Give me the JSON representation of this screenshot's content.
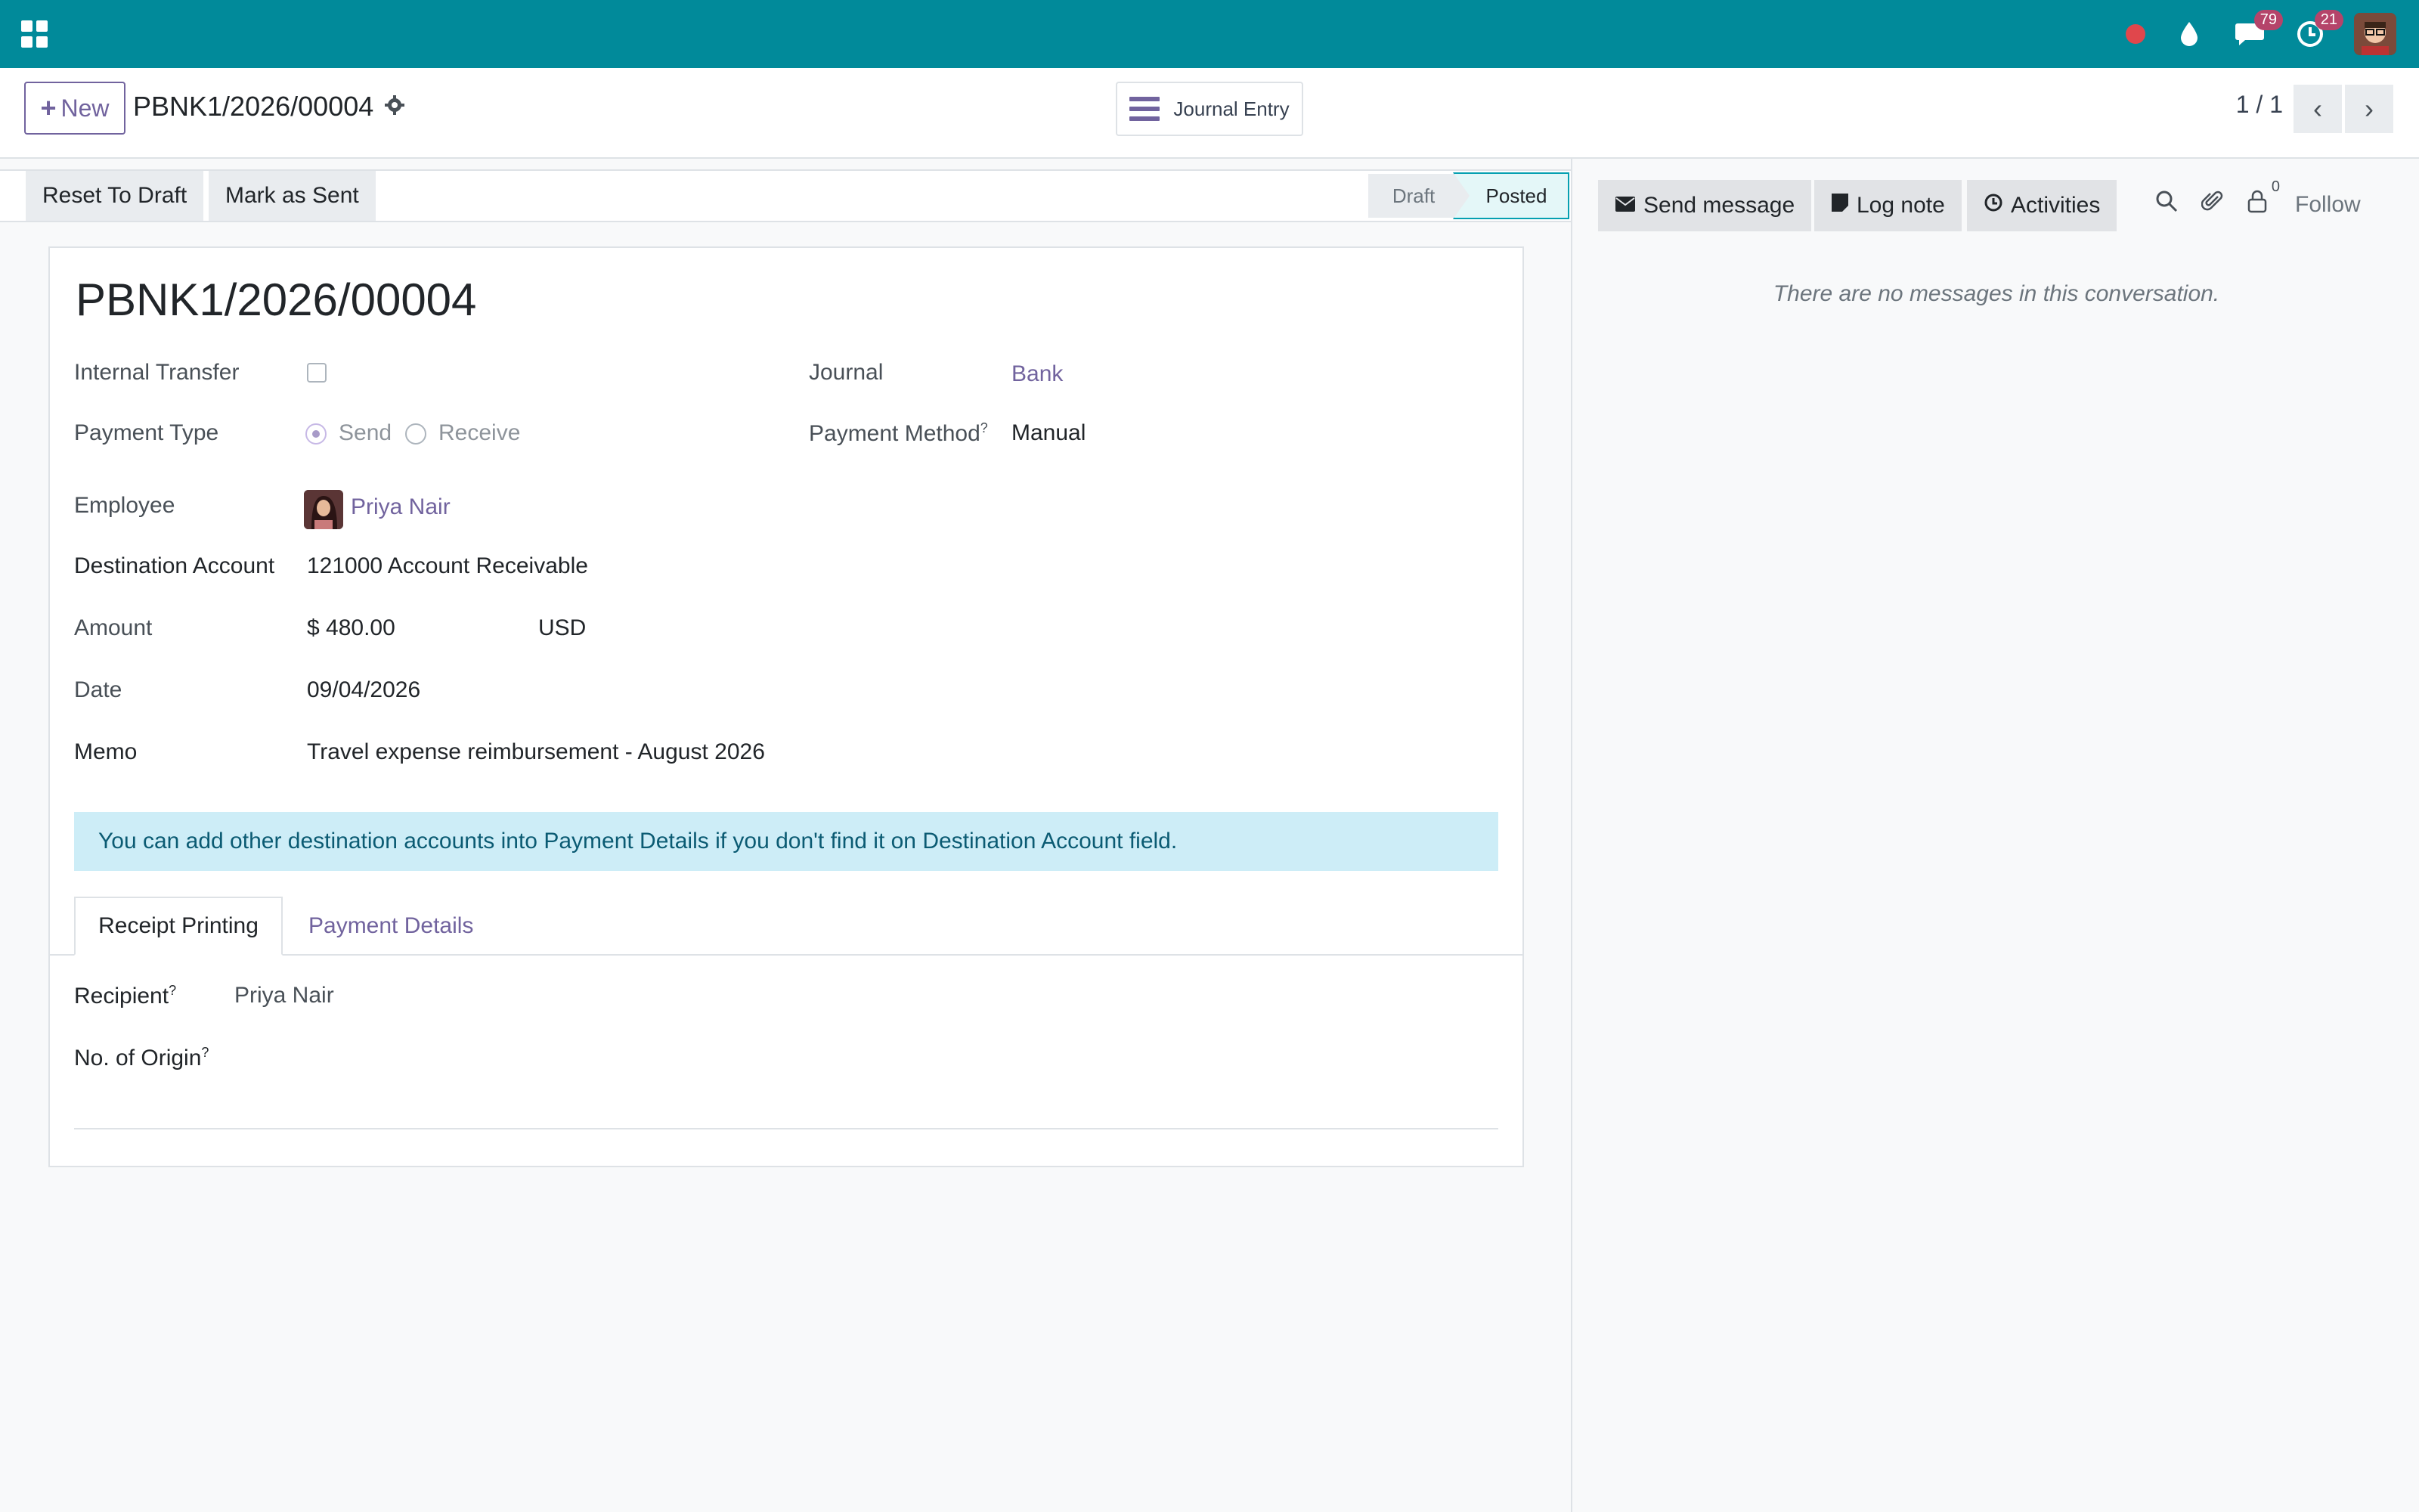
{
  "navbar": {
    "messages_badge": "79",
    "activities_badge": "21"
  },
  "control": {
    "new_label": "New",
    "record_name": "PBNK1/2026/00004",
    "journal_entry_label": "Journal Entry",
    "pager": "1 / 1"
  },
  "statusbar": {
    "reset_label": "Reset To Draft",
    "mark_sent_label": "Mark as Sent",
    "stage_draft": "Draft",
    "stage_posted": "Posted"
  },
  "form": {
    "title": "PBNK1/2026/00004",
    "internal_transfer_label": "Internal Transfer",
    "internal_transfer_value": false,
    "payment_type_label": "Payment Type",
    "payment_type_send": "Send",
    "payment_type_receive": "Receive",
    "journal_label": "Journal",
    "journal_value": "Bank",
    "payment_method_label": "Payment Method",
    "payment_method_value": "Manual",
    "employee_label": "Employee",
    "employee_value": "Priya Nair",
    "destination_account_label": "Destination Account",
    "destination_account_value": "121000 Account Receivable",
    "amount_label": "Amount",
    "amount_value": "$ 480.00",
    "currency_value": "USD",
    "date_label": "Date",
    "date_value": "09/04/2026",
    "memo_label": "Memo",
    "memo_value": "Travel expense reimbursement - August 2026",
    "alert_text": "You can add other destination accounts into Payment Details if you don't find it on Destination Account field.",
    "tabs": [
      "Receipt Printing",
      "Payment Details"
    ],
    "recipient_label": "Recipient",
    "recipient_value": "Priya Nair",
    "origin_label": "No. of Origin",
    "help_marker": "?"
  },
  "chatter": {
    "send_message_label": "Send message",
    "log_note_label": "Log note",
    "activities_label": "Activities",
    "followers_count": "0",
    "follow_label": "Follow",
    "empty_text": "There are no messages in this conversation."
  },
  "colors": {
    "navbar": "#018a9a",
    "brand": "#71639e",
    "alert_bg": "#cdedf7"
  }
}
